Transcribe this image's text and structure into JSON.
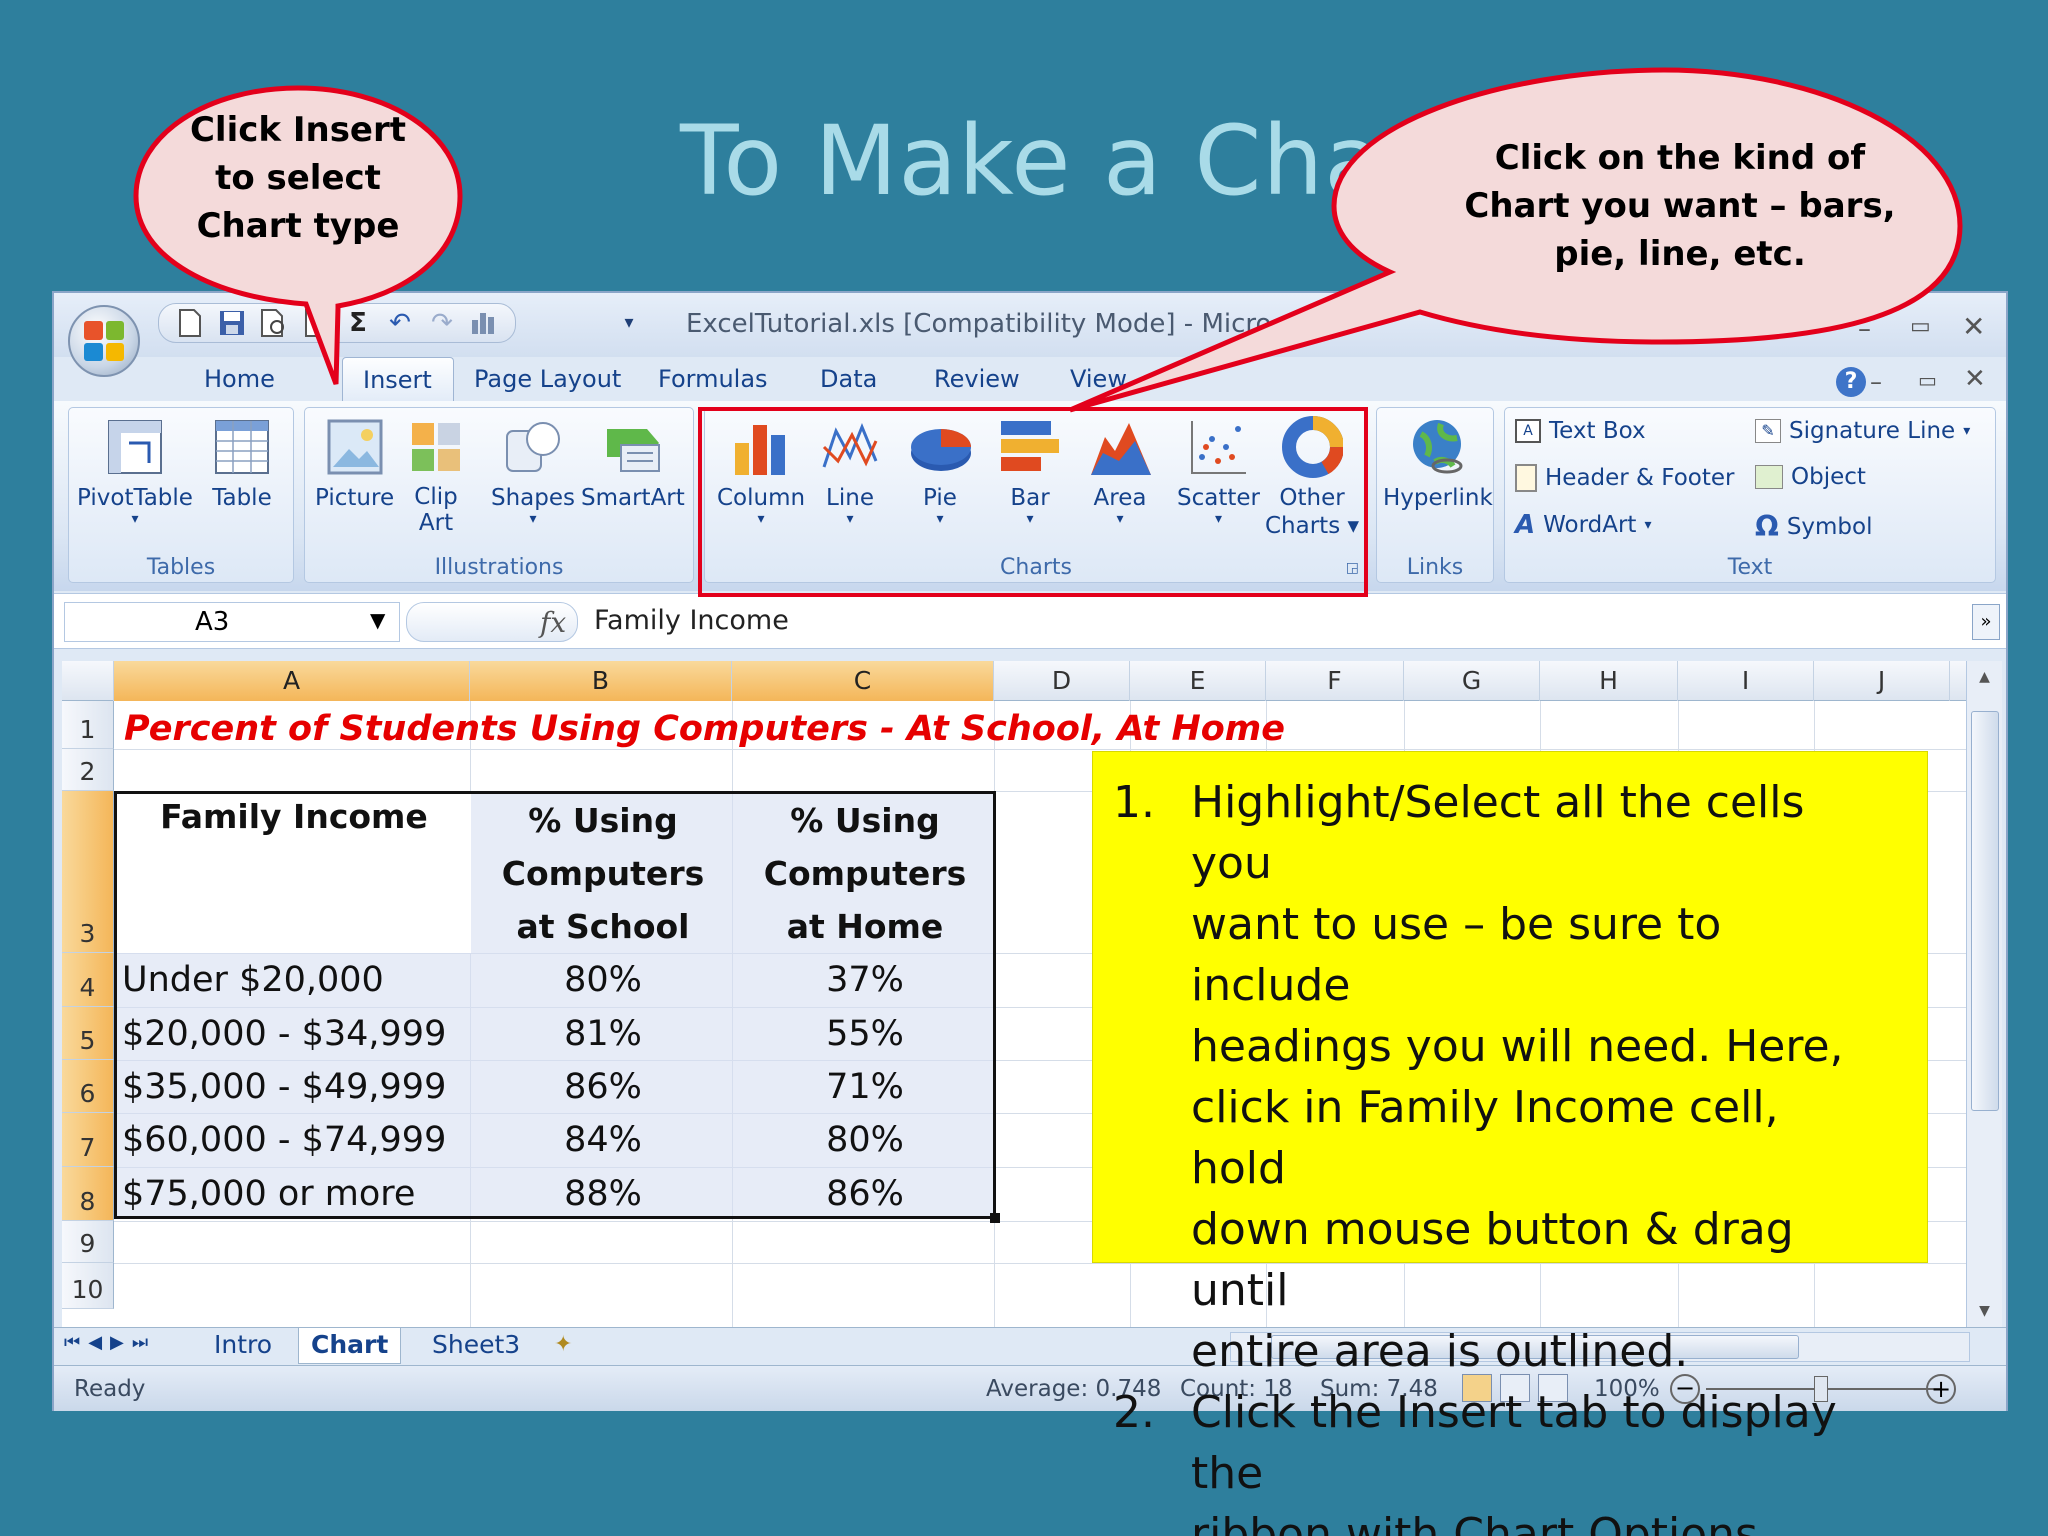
{
  "slide": {
    "title": "To Make a Chart",
    "callout_left": [
      "Click Insert",
      "to  select",
      "Chart type"
    ],
    "callout_right": [
      "Click on the kind of",
      "Chart you want – bars,",
      "pie, line, etc."
    ]
  },
  "window": {
    "title": "ExcelTutorial.xls  [Compatibility Mode] - Micro",
    "tabs": [
      "Home",
      "Insert",
      "Page Layout",
      "Formulas",
      "Data",
      "Review",
      "View"
    ],
    "active_tab": "Insert",
    "help_label": "?"
  },
  "ribbon": {
    "tables": {
      "label": "Tables",
      "buttons": [
        "PivotTable",
        "Table"
      ]
    },
    "illustrations": {
      "label": "Illustrations",
      "buttons": [
        "Picture",
        "Clip",
        "Art",
        "Shapes",
        "SmartArt"
      ]
    },
    "charts": {
      "label": "Charts",
      "buttons": [
        "Column",
        "Line",
        "Pie",
        "Bar",
        "Area",
        "Scatter",
        "Other",
        "Charts"
      ]
    },
    "links": {
      "label": "Links",
      "buttons": [
        "Hyperlink"
      ]
    },
    "text": {
      "label": "Text",
      "buttons": [
        "Text Box",
        "Header & Footer",
        "WordArt",
        "Signature Line",
        "Object",
        "Symbol"
      ]
    }
  },
  "formula_bar": {
    "name_box": "A3",
    "fx": "fx",
    "value": "Family Income"
  },
  "sheet": {
    "columns": [
      "A",
      "B",
      "C",
      "D",
      "E",
      "F",
      "G",
      "H",
      "I",
      "J"
    ],
    "rows": [
      "1",
      "2",
      "3",
      "4",
      "5",
      "6",
      "7",
      "8",
      "9",
      "10"
    ],
    "title": "Percent of Students Using Computers - At School,  At Home",
    "headers": {
      "a": "Family Income",
      "b": [
        "% Using",
        "Computers",
        "at School"
      ],
      "c": [
        "% Using",
        "Computers",
        "at Home"
      ]
    },
    "data": [
      [
        "Under $20,000",
        "80%",
        "37%"
      ],
      [
        "$20,000 - $34,999",
        "81%",
        "55%"
      ],
      [
        "$35,000 - $49,999",
        "86%",
        "71%"
      ],
      [
        "$60,000 - $74,999",
        "84%",
        "80%"
      ],
      [
        "$75,000 or more",
        "88%",
        "86%"
      ]
    ]
  },
  "note": {
    "items": [
      {
        "num": "1.",
        "lines": [
          "Highlight/Select all the cells you",
          "want to use – be sure to include",
          "headings you will need.  Here,",
          "click in Family Income cell, hold",
          "down mouse button & drag until",
          "entire area is outlined."
        ]
      },
      {
        "num": "2.",
        "lines": [
          "Click the Insert tab to display the",
          "ribbon with Chart Options"
        ]
      }
    ]
  },
  "sheet_tabs": [
    "Intro",
    "Chart",
    "Sheet3"
  ],
  "active_sheet": "Chart",
  "status": {
    "ready": "Ready",
    "average": "Average: 0.748",
    "count": "Count: 18",
    "sum": "Sum: 7.48",
    "zoom": "100%"
  },
  "colors": {
    "highlight": "#e3001b",
    "note_bg": "#ffff00",
    "slide_bg": "#2e7f9d",
    "title_red": "#e60000"
  }
}
